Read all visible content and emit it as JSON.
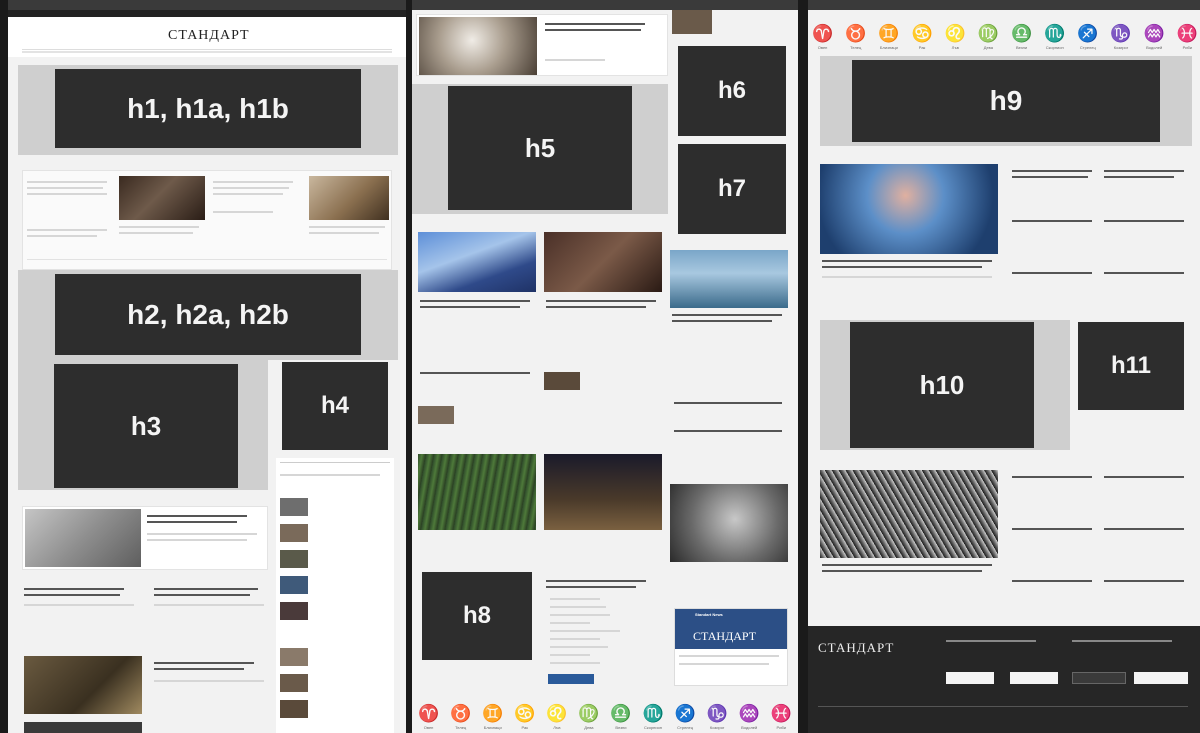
{
  "placeholders": {
    "h1": "h1, h1a, h1b",
    "h2": "h2, h2a, h2b",
    "h3": "h3",
    "h4": "h4",
    "h5": "h5",
    "h6": "h6",
    "h7": "h7",
    "h8": "h8",
    "h9": "h9",
    "h10": "h10",
    "h11": "h11"
  },
  "site": {
    "logo": "СТАНДАРТ",
    "footer_logo": "СТАНДАРТ",
    "promo_logo": "СТАНДАРТ",
    "promo_title": "Standart News"
  },
  "zodiac": [
    {
      "glyph": "♈",
      "label": "Овен"
    },
    {
      "glyph": "♉",
      "label": "Телец"
    },
    {
      "glyph": "♊",
      "label": "Близнаци"
    },
    {
      "glyph": "♋",
      "label": "Рак"
    },
    {
      "glyph": "♌",
      "label": "Лъв"
    },
    {
      "glyph": "♍",
      "label": "Дева"
    },
    {
      "glyph": "♎",
      "label": "Везни"
    },
    {
      "glyph": "♏",
      "label": "Скорпион"
    },
    {
      "glyph": "♐",
      "label": "Стрелец"
    },
    {
      "glyph": "♑",
      "label": "Козирог"
    },
    {
      "glyph": "♒",
      "label": "Водолей"
    },
    {
      "glyph": "♓",
      "label": "Риби"
    }
  ],
  "colors": {
    "ad_block": "#2d2d2d",
    "ad_band": "#cfcfcf",
    "background": "#f2f2f2"
  }
}
